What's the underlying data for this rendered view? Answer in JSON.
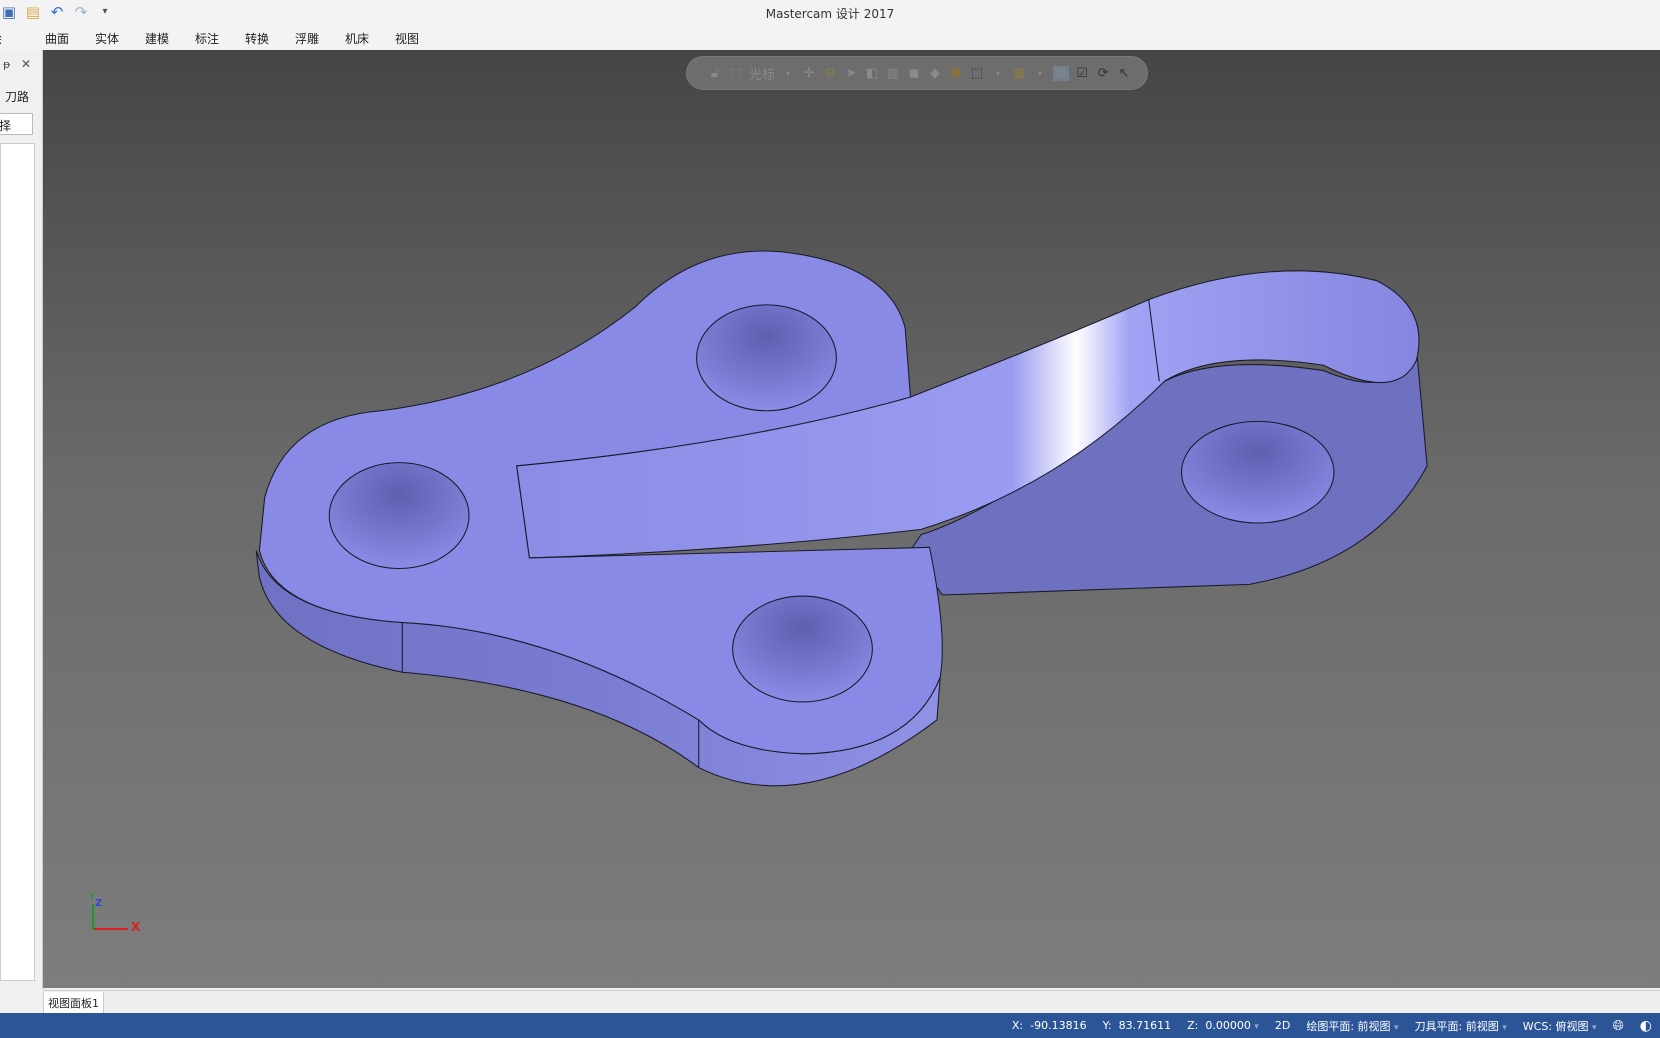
{
  "window": {
    "title": "Mastercam 设计 2017"
  },
  "qat": {
    "icons": [
      "save-icon",
      "open-icon",
      "undo-icon",
      "redo-icon",
      "customize-icon"
    ]
  },
  "menu": [
    "绘图",
    "曲面",
    "实体",
    "建模",
    "标注",
    "转换",
    "浮雕",
    "机床",
    "视图"
  ],
  "left_panel": {
    "tab_label": "刀路",
    "field_text": "择",
    "pin": "ᵽ",
    "close": "✕"
  },
  "toolbar": {
    "cursor_label": "光标"
  },
  "viewport": {
    "tab_label": "视图面板1",
    "part_color": "#8a8ce6",
    "axis_x": "X",
    "axis_y": "Y",
    "axis_z": "Z"
  },
  "status": {
    "x_label": "X:",
    "x": "-90.13816",
    "y_label": "Y:",
    "y": "83.71611",
    "z_label": "Z:",
    "z": "0.00000",
    "mode": "2D",
    "cplane": "绘图平面: 前视图",
    "tplane": "刀具平面: 前视图",
    "wcs": "WCS: 俯视图"
  }
}
